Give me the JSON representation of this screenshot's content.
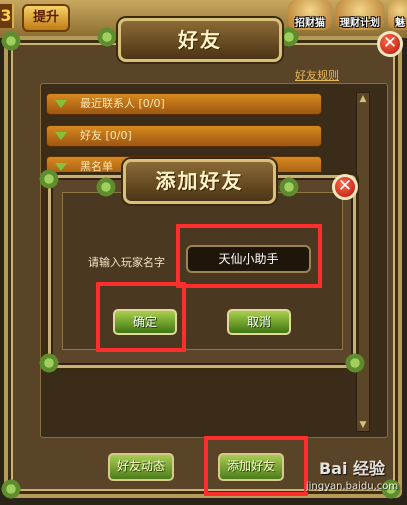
{
  "hud": {
    "level_number": "3",
    "promote_label": "提升",
    "recruit_label": "招财猫",
    "finance_label": "理财计划",
    "extra_label": "魅"
  },
  "friends_panel": {
    "title": "好友",
    "rules_link": "好友规则",
    "groups": [
      {
        "label": "最近联系人 [0/0]"
      },
      {
        "label": "好友 [0/0]"
      },
      {
        "label": "黑名单"
      }
    ],
    "footer": {
      "friend_updates_label": "好友动态",
      "add_friend_label": "添加好友"
    }
  },
  "add_friend_dialog": {
    "title": "添加好友",
    "prompt_label": "请输入玩家名字",
    "player_name_value": "天仙小助手",
    "confirm_label": "确定",
    "cancel_label": "取消"
  },
  "watermark": {
    "brand": "Bai 经验",
    "url": "jingyan.baidu.com"
  },
  "colors": {
    "panel_bg": "#5a4428",
    "group_row": "#d8891f",
    "button_green": "#6ea52a",
    "highlight_red": "#ff2e2e",
    "close_red": "#d42a14"
  }
}
